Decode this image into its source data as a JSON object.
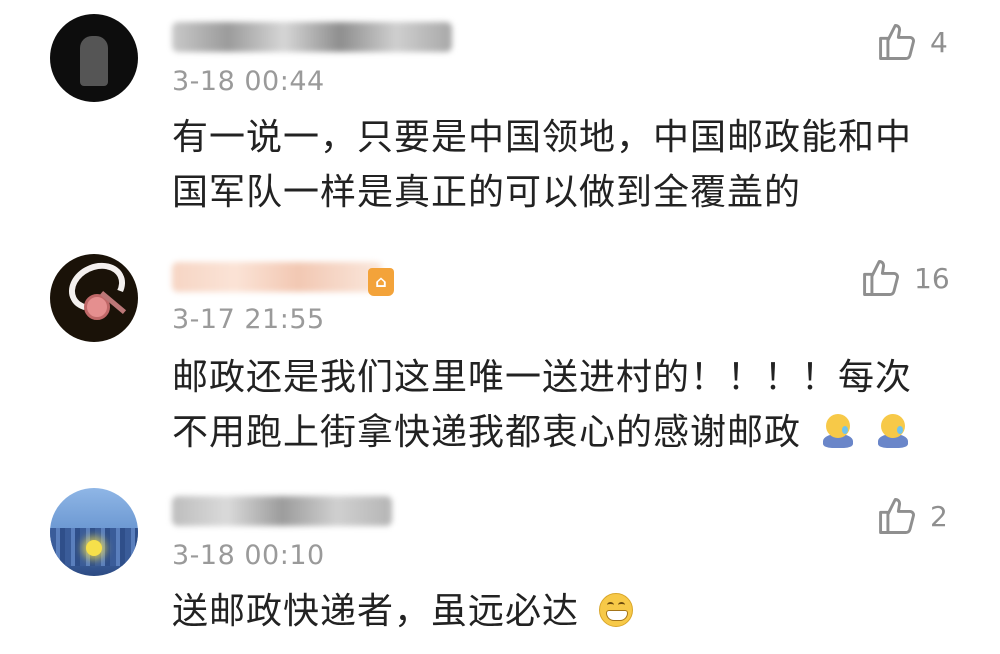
{
  "comments": [
    {
      "time": "3-18 00:44",
      "likes": "4",
      "text_lines": [
        "有一说一，只要是中国领地，中国邮政能和中",
        "国军队一样是真正的可以做到全覆盖的"
      ]
    },
    {
      "time": "3-17 21:55",
      "likes": "16",
      "text_lines": [
        "邮政还是我们这里唯一送进村的！！！！每次",
        "不用跑上街拿快递我都衷心的感谢邮政"
      ],
      "trailing_emojis": [
        "crying-emoji",
        "crying-emoji"
      ]
    },
    {
      "time": "3-18 00:10",
      "likes": "2",
      "text_lines": [
        "送邮政快递者，虽远必达"
      ],
      "trailing_emojis": [
        "grin-emoji"
      ]
    }
  ],
  "colors": {
    "text": "#222222",
    "meta": "#9a9a9a",
    "like": "#8f8f8f",
    "vip_badge": "#f3a33a"
  }
}
